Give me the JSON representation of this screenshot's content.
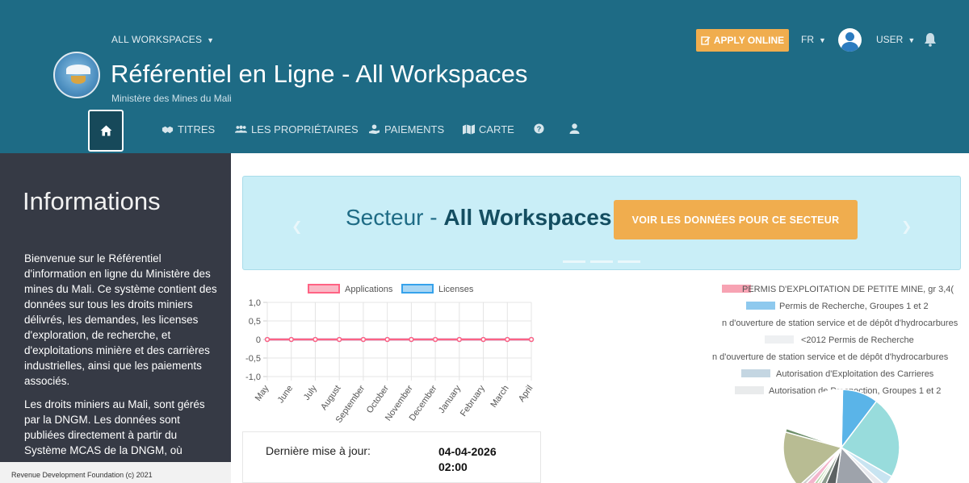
{
  "header": {
    "workspace_select": "ALL WORKSPACES",
    "title": "Référentiel en Ligne - All Workspaces",
    "subtitle": "Ministère des Mines du Mali",
    "apply_label": "APPLY ONLINE",
    "language": "FR",
    "user_label": "USER"
  },
  "nav": {
    "items": [
      {
        "label": "TITRES",
        "icon": "handshake-icon"
      },
      {
        "label": "LES PROPRIÉTAIRES",
        "icon": "users-icon"
      },
      {
        "label": "PAIEMENTS",
        "icon": "hand-coin-icon"
      },
      {
        "label": "CARTE",
        "icon": "map-icon"
      }
    ]
  },
  "sidebar": {
    "title": "Informations",
    "paragraph1": "Bienvenue sur le Référentiel d'information en ligne du Ministère des mines du Mali. Ce système contient des données sur tous les droits miniers délivrés, les demandes, les licenses d'exploration, de recherche, et d'exploitations minière et des carrières industrielles, ainsi que les paiements associés.",
    "paragraph2": "Les droits miniers au Mali, sont gérés par la DNGM. Les données sont publiées directement à partir du Système MCAS de la DNGM, où",
    "footer": "Revenue Development Foundation (c) 2021"
  },
  "banner": {
    "secteur_prefix": "Secteur - ",
    "secteur_name": "All Workspaces",
    "button_label": "VOIR LES DONNÉES POUR CE SECTEUR"
  },
  "update": {
    "label": "Dernière mise à jour:",
    "date": "04-04-2026",
    "time": "02:00"
  },
  "colors": {
    "header_bg": "#1e6b85",
    "sidebar_bg": "#363a45",
    "accent": "#f0ad4e",
    "banner_bg": "#c9eef7"
  },
  "chart_data": [
    {
      "type": "line",
      "x": [
        "May",
        "June",
        "July",
        "August",
        "September",
        "October",
        "November",
        "December",
        "January",
        "February",
        "March",
        "April"
      ],
      "series": [
        {
          "name": "Applications",
          "values": [
            0,
            0,
            0,
            0,
            0,
            0,
            0,
            0,
            0,
            0,
            0,
            0
          ],
          "color": "#ff6384"
        },
        {
          "name": "Licenses",
          "values": [
            0,
            0,
            0,
            0,
            0,
            0,
            0,
            0,
            0,
            0,
            0,
            0
          ],
          "color": "#36a2eb"
        }
      ],
      "y_ticks": [
        "1,0",
        "0,5",
        "0",
        "-0,5",
        "-1,0"
      ],
      "ylim": [
        -1,
        1
      ],
      "grid": true,
      "legend": "top"
    },
    {
      "type": "pie",
      "legend_labels": [
        {
          "label": "PERMIS D'EXPLOITATION DE PETITE MINE, gr 3,4(",
          "color": "#f7a3b3"
        },
        {
          "label": "Permis de Recherche, Groupes 1 et 2",
          "color": "#8ec9ee"
        },
        {
          "label": "n d'ouverture de station service et de dépôt d'hydrocarbures",
          "color": "#ffffff"
        },
        {
          "label": "<2012 Permis de Recherche",
          "color": "#eef0f2"
        },
        {
          "label": "n d'ouverture de station service et de dépôt d'hydrocarbures",
          "color": "#ffffff"
        },
        {
          "label": "Autorisation d'Exploitation des Carrieres",
          "color": "#c4d6e2"
        },
        {
          "label": "Autorisation de Prospection, Groupes 1 et 2",
          "color": "#e9ebec"
        }
      ],
      "slices": [
        {
          "value": 10,
          "color": "#5ab4e8"
        },
        {
          "value": 23,
          "color": "#98dcdc"
        },
        {
          "value": 3,
          "color": "#c8e4f1"
        },
        {
          "value": 2,
          "color": "#e7e9ee"
        },
        {
          "value": 14,
          "color": "#9ea3ab"
        },
        {
          "value": 4,
          "color": "#5d6263"
        },
        {
          "value": 2,
          "color": "#8b9a8c"
        },
        {
          "value": 1,
          "color": "#d7e8c6"
        },
        {
          "value": 1,
          "color": "#b7d6ab"
        },
        {
          "value": 2,
          "color": "#f3b5cc"
        },
        {
          "value": 1,
          "color": "#cfcfcf"
        },
        {
          "value": 16,
          "color": "#b8bc93"
        },
        {
          "value": 1,
          "color": "#6e8f6b"
        },
        {
          "value": 20,
          "color": "#ffffff"
        }
      ]
    }
  ]
}
